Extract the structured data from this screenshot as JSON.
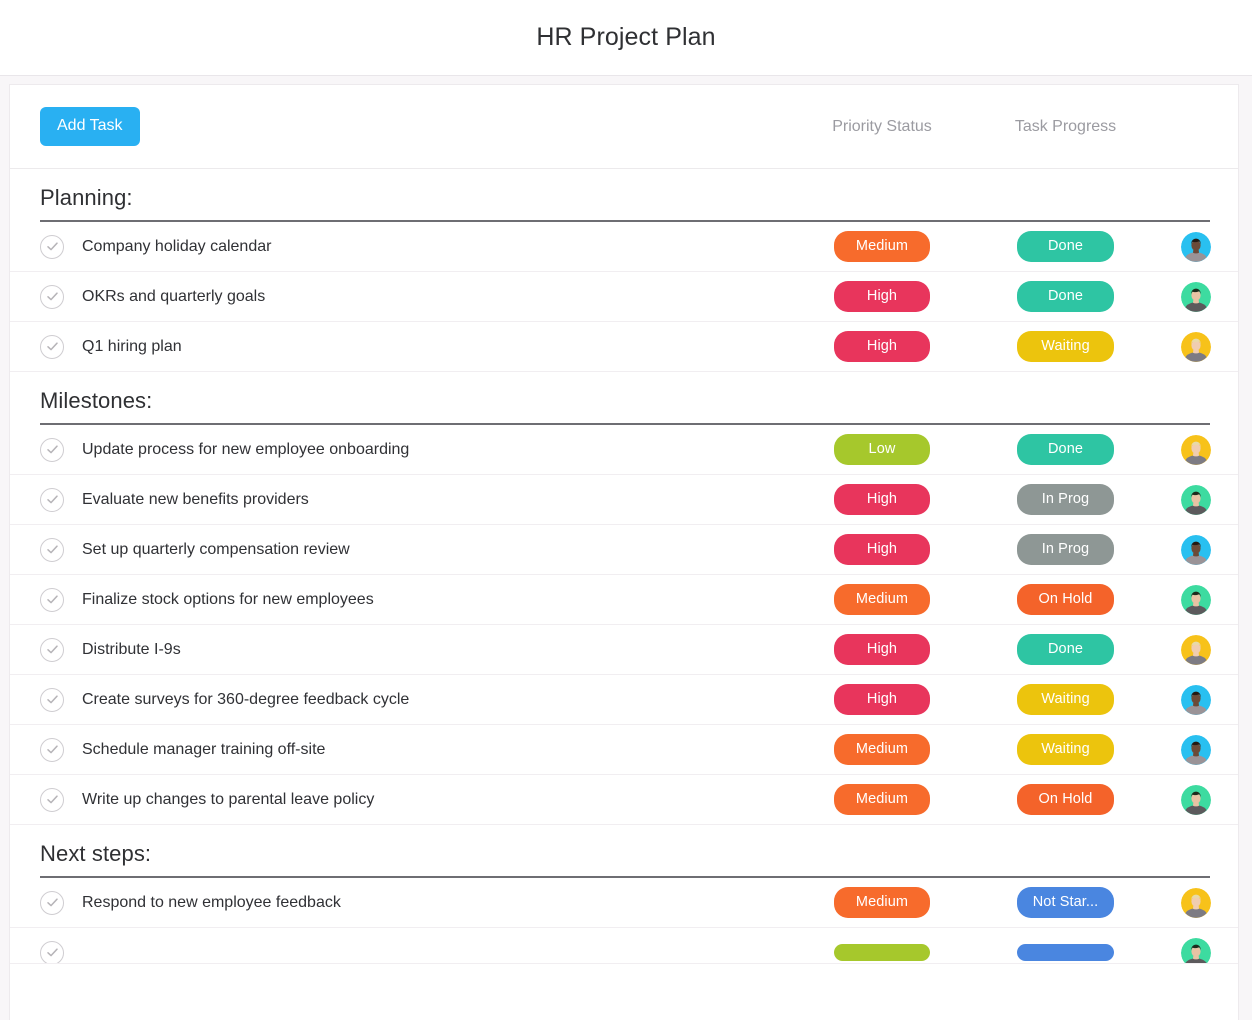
{
  "window": {
    "app_title": "HR Project Plan"
  },
  "toolbar": {
    "add_task_label": "Add Task",
    "priority_header": "Priority Status",
    "progress_header": "Task Progress"
  },
  "colors": {
    "accent_blue": "#29b0f2",
    "priority_high": "#e8355c",
    "priority_medium": "#f76b2c",
    "priority_low": "#a6c82c",
    "status_done": "#2ec5a3",
    "status_waiting": "#ecc40d",
    "status_in_prog": "#8e9795",
    "status_on_hold": "#f4632a",
    "status_not_started": "#4a86e0",
    "section_rule": "#6e6e73",
    "row_divider": "#f1eef1",
    "header_text": "#9b9ba1",
    "task_text": "#303135"
  },
  "sections": [
    {
      "title": "Planning:",
      "tasks": [
        {
          "name": "Company holiday calendar",
          "priority": "Medium",
          "priority_color": "#f76b2c",
          "progress": "Done",
          "progress_color": "#2ec5a3",
          "avatar": "avatar-blue-man",
          "checked": true
        },
        {
          "name": "OKRs and quarterly goals",
          "priority": "High",
          "priority_color": "#e8355c",
          "progress": "Done",
          "progress_color": "#2ec5a3",
          "avatar": "avatar-green-person",
          "checked": true
        },
        {
          "name": "Q1 hiring plan",
          "priority": "High",
          "priority_color": "#e8355c",
          "progress": "Waiting",
          "progress_color": "#ecc40d",
          "avatar": "avatar-yellow-woman",
          "checked": true
        }
      ]
    },
    {
      "title": "Milestones:",
      "tasks": [
        {
          "name": "Update process for new employee onboarding",
          "priority": "Low",
          "priority_color": "#a6c82c",
          "progress": "Done",
          "progress_color": "#2ec5a3",
          "avatar": "avatar-yellow-woman",
          "checked": true
        },
        {
          "name": "Evaluate new benefits providers",
          "priority": "High",
          "priority_color": "#e8355c",
          "progress": "In Prog",
          "progress_color": "#8e9795",
          "avatar": "avatar-green-person",
          "checked": true
        },
        {
          "name": "Set up quarterly compensation review",
          "priority": "High",
          "priority_color": "#e8355c",
          "progress": "In Prog",
          "progress_color": "#8e9795",
          "avatar": "avatar-blue-man",
          "checked": true
        },
        {
          "name": "Finalize stock options for new employees",
          "priority": "Medium",
          "priority_color": "#f76b2c",
          "progress": "On Hold",
          "progress_color": "#f4632a",
          "avatar": "avatar-green-person",
          "checked": true
        },
        {
          "name": "Distribute I-9s",
          "priority": "High",
          "priority_color": "#e8355c",
          "progress": "Done",
          "progress_color": "#2ec5a3",
          "avatar": "avatar-yellow-woman",
          "checked": true
        },
        {
          "name": "Create surveys for 360-degree feedback cycle",
          "priority": "High",
          "priority_color": "#e8355c",
          "progress": "Waiting",
          "progress_color": "#ecc40d",
          "avatar": "avatar-blue-man",
          "checked": true
        },
        {
          "name": "Schedule manager training off-site",
          "priority": "Medium",
          "priority_color": "#f76b2c",
          "progress": "Waiting",
          "progress_color": "#ecc40d",
          "avatar": "avatar-blue-man",
          "checked": true
        },
        {
          "name": "Write up changes to parental leave policy",
          "priority": "Medium",
          "priority_color": "#f76b2c",
          "progress": "On Hold",
          "progress_color": "#f4632a",
          "avatar": "avatar-green-person",
          "checked": true
        }
      ]
    },
    {
      "title": "Next steps:",
      "tasks": [
        {
          "name": "Respond to new employee feedback",
          "priority": "Medium",
          "priority_color": "#f76b2c",
          "progress": "Not Star...",
          "progress_color": "#4a86e0",
          "avatar": "avatar-yellow-woman",
          "checked": true
        },
        {
          "name": "",
          "priority": "",
          "priority_color": "#a6c82c",
          "progress": "",
          "progress_color": "#4a86e0",
          "avatar": "avatar-green-person",
          "checked": true,
          "partial": true
        }
      ]
    }
  ]
}
